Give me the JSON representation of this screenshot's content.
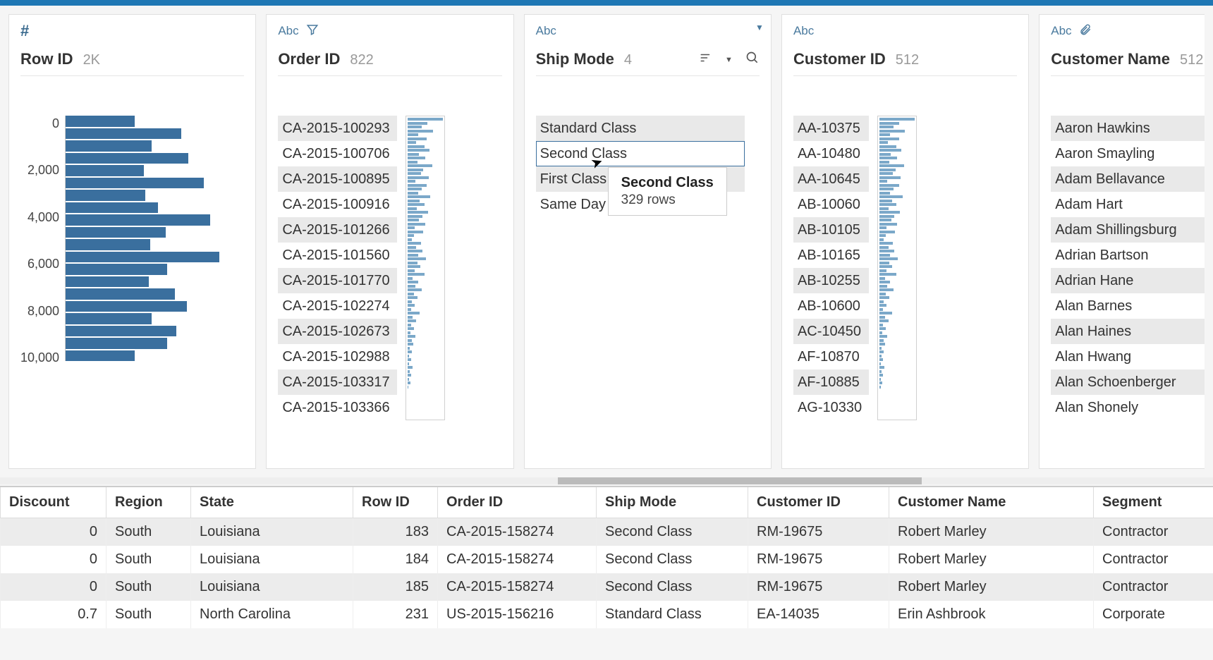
{
  "types": {
    "number": "#",
    "text": "Abc"
  },
  "cards": {
    "rowid": {
      "title": "Row ID",
      "count": "2K"
    },
    "order": {
      "title": "Order ID",
      "count": "822",
      "values": [
        "CA-2015-100293",
        "CA-2015-100706",
        "CA-2015-100895",
        "CA-2015-100916",
        "CA-2015-101266",
        "CA-2015-101560",
        "CA-2015-101770",
        "CA-2015-102274",
        "CA-2015-102673",
        "CA-2015-102988",
        "CA-2015-103317",
        "CA-2015-103366"
      ]
    },
    "ship": {
      "title": "Ship Mode",
      "count": "4",
      "values": [
        "Standard Class",
        "Second Class",
        "First Class",
        "Same Day"
      ],
      "tooltip": {
        "title": "Second Class",
        "sub": "329 rows"
      }
    },
    "customer": {
      "title": "Customer ID",
      "count": "512",
      "values": [
        "AA-10375",
        "AA-10480",
        "AA-10645",
        "AB-10060",
        "AB-10105",
        "AB-10165",
        "AB-10255",
        "AB-10600",
        "AC-10450",
        "AF-10870",
        "AF-10885",
        "AG-10330"
      ]
    },
    "name": {
      "title": "Customer Name",
      "count": "512",
      "values": [
        "Aaron Hawkins",
        "Aaron Smayling",
        "Adam Bellavance",
        "Adam Hart",
        "Adam Shillingsburg",
        "Adrian Bartson",
        "Adrian Hane",
        "Alan Barnes",
        "Alan Haines",
        "Alan Hwang",
        "Alan Schoenberger",
        "Alan Shonely"
      ]
    }
  },
  "chart_data": {
    "type": "bar",
    "orientation": "horizontal",
    "title": "Row ID",
    "y_ticks": [
      "0",
      "2,000",
      "4,000",
      "6,000",
      "8,000",
      "10,000"
    ],
    "bars_pct": [
      45,
      75,
      56,
      80,
      51,
      90,
      52,
      60,
      94,
      65,
      55,
      100,
      66,
      54,
      71,
      79,
      56,
      72,
      66,
      45
    ]
  },
  "grid": {
    "headers": [
      "Discount",
      "Region",
      "State",
      "Row ID",
      "Order ID",
      "Ship Mode",
      "Customer ID",
      "Customer Name",
      "Segment"
    ],
    "rows": [
      {
        "discount": "0",
        "region": "South",
        "state": "Louisiana",
        "rowid": "183",
        "orderid": "CA-2015-158274",
        "ship": "Second Class",
        "custid": "RM-19675",
        "custname": "Robert Marley",
        "segment": "Contractor"
      },
      {
        "discount": "0",
        "region": "South",
        "state": "Louisiana",
        "rowid": "184",
        "orderid": "CA-2015-158274",
        "ship": "Second Class",
        "custid": "RM-19675",
        "custname": "Robert Marley",
        "segment": "Contractor"
      },
      {
        "discount": "0",
        "region": "South",
        "state": "Louisiana",
        "rowid": "185",
        "orderid": "CA-2015-158274",
        "ship": "Second Class",
        "custid": "RM-19675",
        "custname": "Robert Marley",
        "segment": "Contractor"
      },
      {
        "discount": "0.7",
        "region": "South",
        "state": "North Carolina",
        "rowid": "231",
        "orderid": "US-2015-156216",
        "ship": "Standard Class",
        "custid": "EA-14035",
        "custname": "Erin Ashbrook",
        "segment": "Corporate"
      }
    ]
  }
}
